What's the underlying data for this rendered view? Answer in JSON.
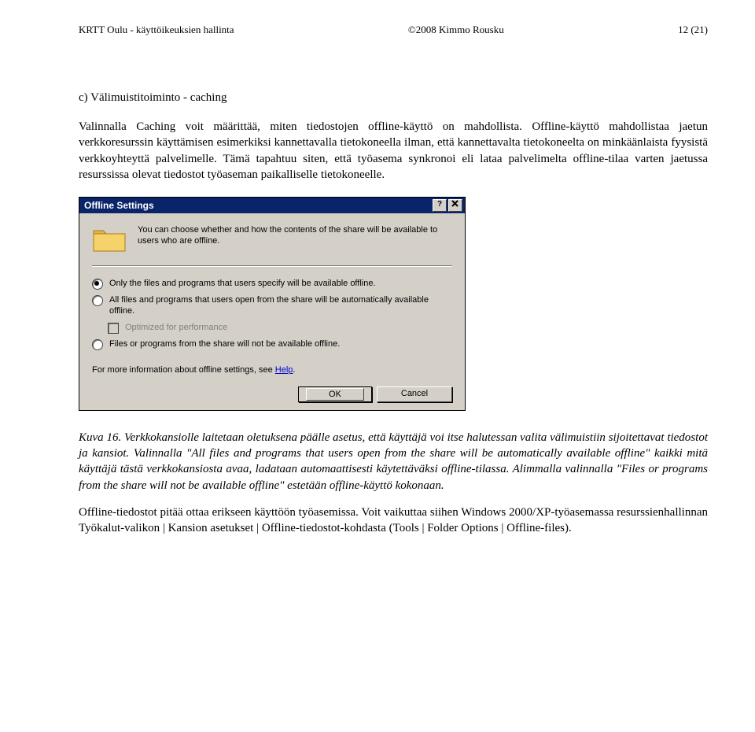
{
  "header": {
    "left": "KRTT Oulu - käyttöikeuksien hallinta",
    "center": "©2008 Kimmo Rousku",
    "right": "12 (21)"
  },
  "section_title": "c) Välimuistitoiminto - caching",
  "para1": "Valinnalla Caching voit määrittää, miten tiedostojen offline-käyttö on mahdollista. Offline-käyttö mahdollistaa jaetun verkkoresurssin käyttämisen esimerkiksi kannettavalla tietokoneella ilman, että kannettavalta tietokoneelta on minkäänlaista fyysistä verkkoyhteyttä palvelimelle. Tämä tapahtuu siten, että työasema synkronoi eli lataa palvelimelta offline-tilaa varten jaetussa resurssissa olevat tiedostot työaseman paikalliselle tietokoneelle.",
  "dialog": {
    "title": "Offline Settings",
    "intro": "You can choose whether and how the contents of the share will be available to users who are offline.",
    "opt1": "Only the files and programs that users specify will be available offline.",
    "opt2": "All files and programs that users open from the share will be automatically available offline.",
    "opt2_sub": "Optimized for performance",
    "opt3": "Files or programs from the share will not be available offline.",
    "help_prefix": "For more information about offline settings, see ",
    "help_link": "Help",
    "help_suffix": ".",
    "ok": "OK",
    "cancel": "Cancel"
  },
  "caption_label": "Kuva 16.",
  "caption_body": " Verkkokansiolle laitetaan oletuksena päälle asetus, että käyttäjä voi itse halutessan valita välimuistiin sijoitettavat tiedostot ja kansiot. Valinnalla \"All files and programs that users open from the share will be automatically available offline\" kaikki mitä käyttäjä tästä verkkokansiosta avaa, ladataan automaattisesti käytettäväksi offline-tilassa. Alimmalla valinnalla \"Files or programs from the share will not be available offline\" estetään offline-käyttö kokonaan.",
  "para3": "Offline-tiedostot pitää ottaa erikseen käyttöön työasemissa. Voit vaikuttaa siihen Windows 2000/XP-työasemassa resurssienhallinnan Työkalut-valikon | Kansion asetukset | Offline-tiedostot-kohdasta (Tools | Folder Options | Offline-files)."
}
